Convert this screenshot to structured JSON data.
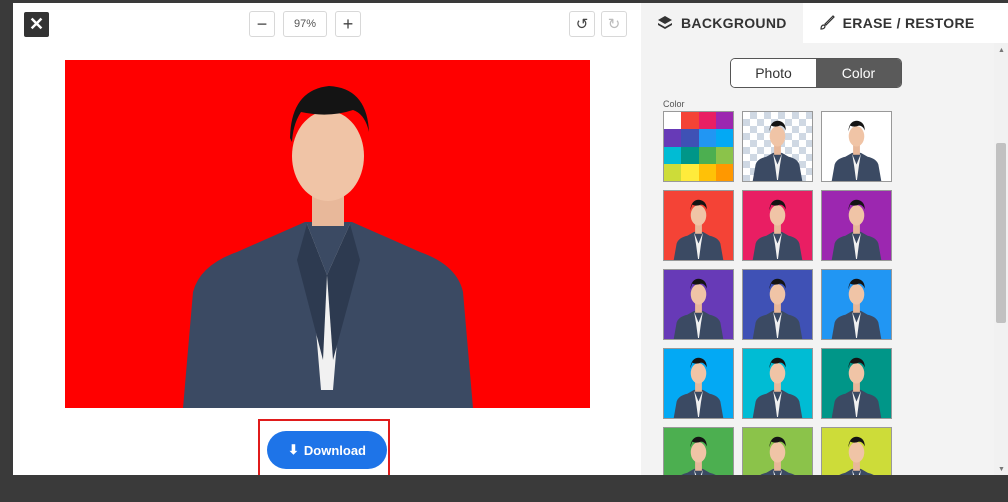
{
  "toolbar": {
    "close_icon": "close-icon",
    "zoom_out": "−",
    "zoom_value": "97%",
    "zoom_in": "+",
    "undo_icon": "↺",
    "redo_icon": "↻"
  },
  "editor": {
    "background_color": "#ff0000",
    "download_label": "Download"
  },
  "panel": {
    "tabs": [
      {
        "label": "BACKGROUND",
        "icon": "layers-icon"
      },
      {
        "label": "ERASE / RESTORE",
        "icon": "brush-icon"
      }
    ],
    "mode_options": [
      "Photo",
      "Color"
    ],
    "selected_mode": "Color",
    "color_label": "Color",
    "palette_colors": [
      "#ffffff",
      "#f44336",
      "#e91e63",
      "#9c27b0",
      "#673ab7",
      "#3f51b5",
      "#2196f3",
      "#03a9f4",
      "#00bcd4",
      "#009688",
      "#4caf50",
      "#8bc34a",
      "#cddc39",
      "#ffeb3b",
      "#ffc107",
      "#ff9800"
    ],
    "swatches": [
      {
        "type": "palette"
      },
      {
        "type": "transparent"
      },
      {
        "type": "color",
        "color": "#ffffff"
      },
      {
        "type": "color",
        "color": "#f44336"
      },
      {
        "type": "color",
        "color": "#e91e63"
      },
      {
        "type": "color",
        "color": "#9c27b0"
      },
      {
        "type": "color",
        "color": "#673ab7"
      },
      {
        "type": "color",
        "color": "#3f51b5"
      },
      {
        "type": "color",
        "color": "#2196f3"
      },
      {
        "type": "color",
        "color": "#03a9f4"
      },
      {
        "type": "color",
        "color": "#00bcd4"
      },
      {
        "type": "color",
        "color": "#009688"
      },
      {
        "type": "color",
        "color": "#4caf50"
      },
      {
        "type": "color",
        "color": "#8bc34a"
      },
      {
        "type": "color",
        "color": "#cddc39"
      }
    ]
  }
}
